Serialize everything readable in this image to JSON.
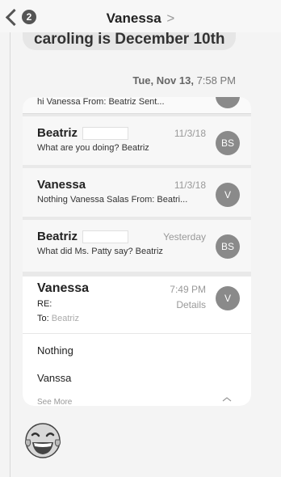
{
  "header": {
    "back_badge": "2",
    "title": "Vanessa",
    "title_chevron": ">"
  },
  "previous_message": {
    "text": "caroling is December 10th"
  },
  "timestamp": {
    "date": "Tue, Nov 13,",
    "time": " 7:58 PM"
  },
  "thread": {
    "cutoff_snippet": "hi Vanessa          From: Beatriz Sent...",
    "rows": [
      {
        "sender": "Beatriz",
        "date": "11/3/18",
        "snippet": "What are you doing? Beatriz",
        "avatar": "BS"
      },
      {
        "sender": "Vanessa",
        "date": "11/3/18",
        "snippet": "Nothing Vanessa Salas From: Beatri...",
        "avatar": "V"
      },
      {
        "sender": "Beatriz",
        "date": "Yesterday",
        "snippet": "What did Ms. Patty say? Beatriz",
        "avatar": "BS"
      }
    ],
    "expanded": {
      "sender": "Vanessa",
      "time": "7:49 PM",
      "details_label": "Details",
      "subject": "RE:",
      "to_label": "To:",
      "to_name": "Beatriz",
      "body_line1": "Nothing",
      "body_line2": "Vanssa",
      "see_more": "See More",
      "avatar": "V"
    }
  },
  "colors": {
    "avatar": "#8a8a8a",
    "background": "#f4f4f4",
    "muted_text": "#999999"
  }
}
